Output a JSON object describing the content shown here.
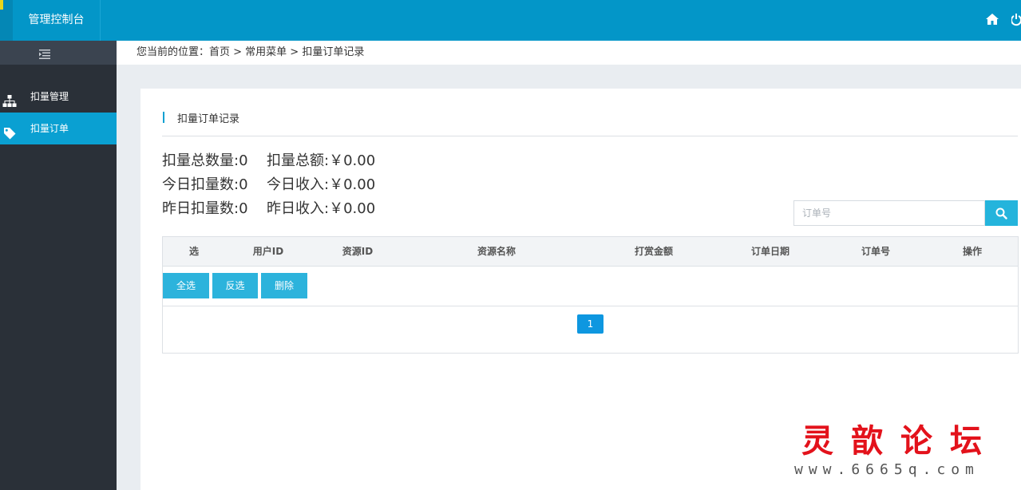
{
  "topbar": {
    "title": "管理控制台",
    "home_icon": "home-icon",
    "power_icon": "power-icon"
  },
  "sidebar": {
    "items": [
      {
        "label": "扣量管理",
        "icon": "sitemap-icon"
      },
      {
        "label": "扣量订单",
        "icon": "tag-icon"
      }
    ]
  },
  "breadcrumb": {
    "text": "您当前的位置：首页 > 常用菜单 > 扣量订单记录"
  },
  "panel": {
    "title": "扣量订单记录"
  },
  "stats": {
    "total_count": "扣量总数量:0",
    "total_amount": "扣量总额:￥0.00",
    "today_count": "今日扣量数:0",
    "today_income": "今日收入:￥0.00",
    "yesterday_count": "昨日扣量数:0",
    "yesterday_income": "昨日收入:￥0.00"
  },
  "search": {
    "placeholder": "订单号"
  },
  "table": {
    "columns": [
      "选",
      "用户ID",
      "资源ID",
      "资源名称",
      "打赏金额",
      "订单日期",
      "订单号",
      "操作"
    ]
  },
  "actions": {
    "select_all": "全选",
    "invert": "反选",
    "delete": "删除"
  },
  "pagination": {
    "current_page": "1"
  },
  "watermark": {
    "cn": "灵歆论坛",
    "url": "www.6665q.com"
  },
  "colors": {
    "topbar": "#0396c8",
    "sidebar": "#2a3038",
    "accent": "#0aa0d2",
    "button": "#2cb3dc"
  }
}
